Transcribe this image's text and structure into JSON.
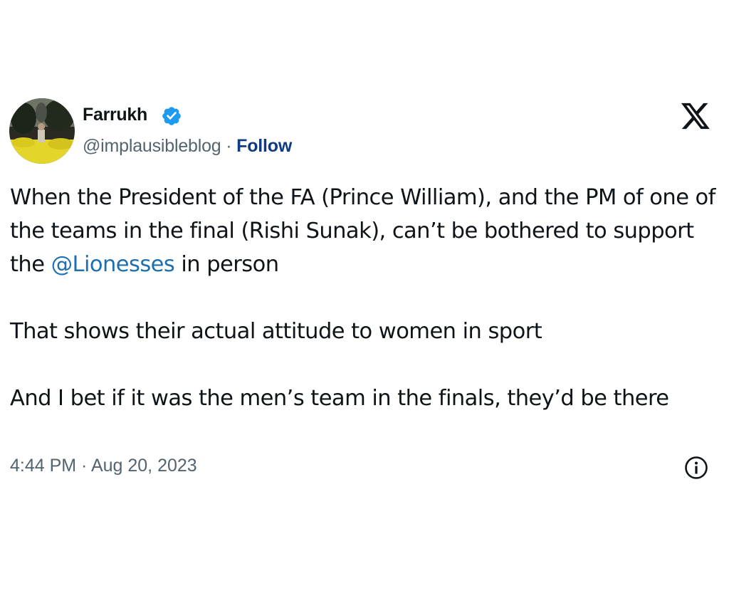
{
  "tweet": {
    "author": {
      "display_name": "Farrukh",
      "verified": true,
      "handle": "@implausibleblog",
      "separator": " · ",
      "follow_label": "Follow"
    },
    "platform_icon": "x-logo-icon",
    "text": {
      "paragraph_1_before": "When the President of the FA (Prince William), and the PM of one of the teams in the final (Rishi Sunak), can’t be bothered to support the ",
      "mention": "@Lionesses",
      "paragraph_1_after": " in person",
      "paragraph_2": "That shows their actual attitude to women in sport",
      "paragraph_3": "And I bet if it was the men’s team in the finals, they’d be there"
    },
    "timestamp": "4:44 PM · Aug 20, 2023",
    "info_icon": "info-circle-icon"
  },
  "colors": {
    "text": "#0f1419",
    "secondary": "#536471",
    "link": "#1d6fb0",
    "follow": "#0f3b80",
    "verified_badge": "#1d9bf0"
  }
}
